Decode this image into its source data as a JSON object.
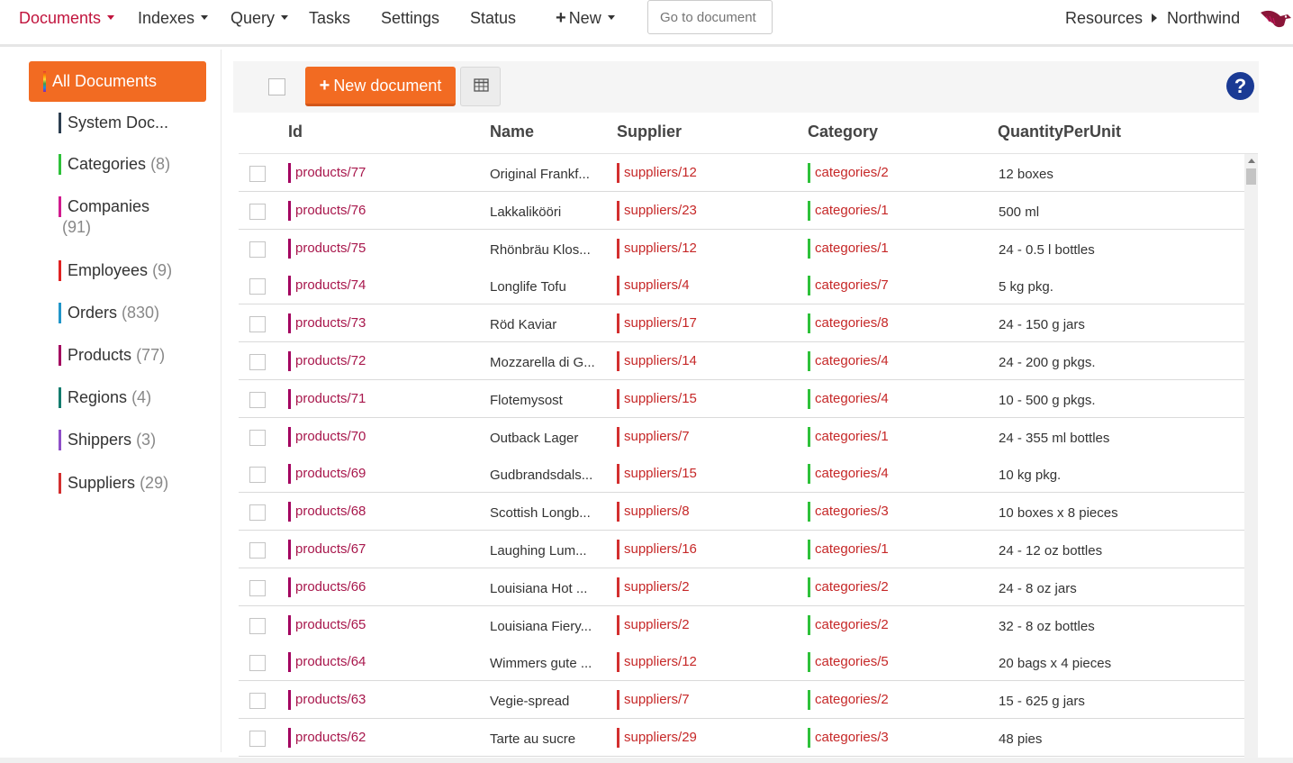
{
  "nav": {
    "documents": "Documents",
    "indexes": "Indexes",
    "query": "Query",
    "tasks": "Tasks",
    "settings": "Settings",
    "status": "Status",
    "new": "New",
    "goto_placeholder": "Go to document",
    "resources": "Resources",
    "database": "Northwind",
    "active_color": "#c1143d",
    "logo_icon": "raven-logo-icon"
  },
  "sidebar": {
    "all_documents": "All Documents",
    "collections": [
      {
        "name": "System Doc...",
        "count": "",
        "color": "#2c3e50"
      },
      {
        "name": "Categories",
        "count": "(8)",
        "color": "#2ec13a"
      },
      {
        "name": "Companies",
        "count": "(91)",
        "color": "#d11a8e"
      },
      {
        "name": "Employees",
        "count": "(9)",
        "color": "#e02222"
      },
      {
        "name": "Orders",
        "count": "(830)",
        "color": "#2196c9"
      },
      {
        "name": "Products",
        "count": "(77)",
        "color": "#a3005f"
      },
      {
        "name": "Regions",
        "count": "(4)",
        "color": "#137c6e"
      },
      {
        "name": "Shippers",
        "count": "(3)",
        "color": "#8e4fc8"
      },
      {
        "name": "Suppliers",
        "count": "(29)",
        "color": "#d32f2f"
      }
    ]
  },
  "toolbar": {
    "new_document": "New document",
    "accent": "#f26b22",
    "grid_icon": "table-grid-icon",
    "help_icon": "question-mark-icon"
  },
  "table": {
    "columns": [
      "Id",
      "Name",
      "Supplier",
      "Category",
      "QuantityPerUnit"
    ],
    "rows": [
      {
        "id": "products/77",
        "name": "Original Frankf...",
        "supplier": "suppliers/12",
        "category": "categories/2",
        "qty": "12 boxes"
      },
      {
        "id": "products/76",
        "name": "Lakkalikööri",
        "supplier": "suppliers/23",
        "category": "categories/1",
        "qty": "500 ml"
      },
      {
        "id": "products/75",
        "name": "Rhönbräu Klos...",
        "supplier": "suppliers/12",
        "category": "categories/1",
        "qty": "24 - 0.5 l bottles"
      },
      {
        "id": "products/74",
        "name": "Longlife Tofu",
        "supplier": "suppliers/4",
        "category": "categories/7",
        "qty": "5 kg pkg."
      },
      {
        "id": "products/73",
        "name": "Röd Kaviar",
        "supplier": "suppliers/17",
        "category": "categories/8",
        "qty": "24 - 150 g jars"
      },
      {
        "id": "products/72",
        "name": "Mozzarella di G...",
        "supplier": "suppliers/14",
        "category": "categories/4",
        "qty": "24 - 200 g pkgs."
      },
      {
        "id": "products/71",
        "name": "Flotemysost",
        "supplier": "suppliers/15",
        "category": "categories/4",
        "qty": "10 - 500 g pkgs."
      },
      {
        "id": "products/70",
        "name": "Outback Lager",
        "supplier": "suppliers/7",
        "category": "categories/1",
        "qty": "24 - 355 ml bottles"
      },
      {
        "id": "products/69",
        "name": "Gudbrandsdals...",
        "supplier": "suppliers/15",
        "category": "categories/4",
        "qty": "10 kg pkg."
      },
      {
        "id": "products/68",
        "name": "Scottish Longb...",
        "supplier": "suppliers/8",
        "category": "categories/3",
        "qty": "10 boxes x 8 pieces"
      },
      {
        "id": "products/67",
        "name": "Laughing Lum...",
        "supplier": "suppliers/16",
        "category": "categories/1",
        "qty": "24 - 12 oz bottles"
      },
      {
        "id": "products/66",
        "name": "Louisiana Hot ...",
        "supplier": "suppliers/2",
        "category": "categories/2",
        "qty": "24 - 8 oz jars"
      },
      {
        "id": "products/65",
        "name": "Louisiana Fiery...",
        "supplier": "suppliers/2",
        "category": "categories/2",
        "qty": "32 - 8 oz bottles"
      },
      {
        "id": "products/64",
        "name": "Wimmers gute ...",
        "supplier": "suppliers/12",
        "category": "categories/5",
        "qty": "20 bags x 4 pieces"
      },
      {
        "id": "products/63",
        "name": "Vegie-spread",
        "supplier": "suppliers/7",
        "category": "categories/2",
        "qty": "15 - 625 g jars"
      },
      {
        "id": "products/62",
        "name": "Tarte au sucre",
        "supplier": "suppliers/29",
        "category": "categories/3",
        "qty": "48 pies"
      }
    ]
  }
}
